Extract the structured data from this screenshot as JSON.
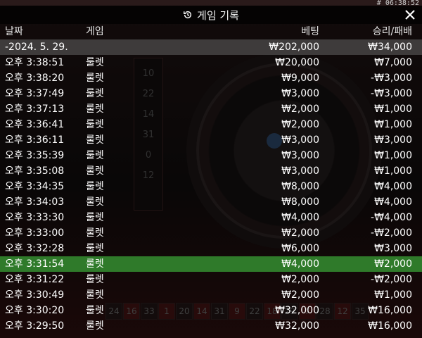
{
  "clock": "# 06:38:52",
  "header": {
    "title": "게임 기록",
    "icon": "history-icon",
    "close_icon": "close-icon"
  },
  "columns": {
    "date": "날짜",
    "game": "게임",
    "bet": "베팅",
    "result": "승리/패배"
  },
  "summary": {
    "date": "-2024. 5. 29.",
    "bet": "₩202,000",
    "result": "₩34,000"
  },
  "rows": [
    {
      "time": "오후 3:38:51",
      "game": "룰렛",
      "bet": "₩20,000",
      "result": "₩7,000"
    },
    {
      "time": "오후 3:38:20",
      "game": "룰렛",
      "bet": "₩9,000",
      "result": "-₩3,000"
    },
    {
      "time": "오후 3:37:49",
      "game": "룰렛",
      "bet": "₩3,000",
      "result": "-₩3,000"
    },
    {
      "time": "오후 3:37:13",
      "game": "룰렛",
      "bet": "₩2,000",
      "result": "₩1,000"
    },
    {
      "time": "오후 3:36:41",
      "game": "룰렛",
      "bet": "₩2,000",
      "result": "₩1,000"
    },
    {
      "time": "오후 3:36:11",
      "game": "룰렛",
      "bet": "₩3,000",
      "result": "₩3,000"
    },
    {
      "time": "오후 3:35:39",
      "game": "룰렛",
      "bet": "₩3,000",
      "result": "₩1,000"
    },
    {
      "time": "오후 3:35:08",
      "game": "룰렛",
      "bet": "₩3,000",
      "result": "₩1,000"
    },
    {
      "time": "오후 3:34:35",
      "game": "룰렛",
      "bet": "₩8,000",
      "result": "₩4,000"
    },
    {
      "time": "오후 3:34:03",
      "game": "룰렛",
      "bet": "₩8,000",
      "result": "₩4,000"
    },
    {
      "time": "오후 3:33:30",
      "game": "룰렛",
      "bet": "₩4,000",
      "result": "-₩4,000"
    },
    {
      "time": "오후 3:33:00",
      "game": "룰렛",
      "bet": "₩2,000",
      "result": "-₩2,000"
    },
    {
      "time": "오후 3:32:28",
      "game": "룰렛",
      "bet": "₩6,000",
      "result": "₩3,000"
    },
    {
      "time": "오후 3:31:54",
      "game": "룰렛",
      "bet": "₩4,000",
      "result": "₩2,000",
      "highlight": true
    },
    {
      "time": "오후 3:31:22",
      "game": "룰렛",
      "bet": "₩2,000",
      "result": "-₩2,000"
    },
    {
      "time": "오후 3:30:49",
      "game": "룰렛",
      "bet": "₩2,000",
      "result": "₩1,000"
    },
    {
      "time": "오후 3:30:20",
      "game": "룰렛",
      "bet": "₩32,000",
      "result": "₩16,000"
    },
    {
      "time": "오후 3:29:50",
      "game": "룰렛",
      "bet": "₩32,000",
      "result": "₩16,000"
    }
  ],
  "background": {
    "strip_numbers": [
      "10",
      "22",
      "14",
      "31",
      "0",
      "12"
    ],
    "number_row": [
      "24",
      "16",
      "33",
      "1",
      "20",
      "14",
      "31",
      "9",
      "22",
      "18",
      "29",
      "7",
      "28",
      "12",
      "35"
    ]
  },
  "colors": {
    "highlight": "#2f7a2a",
    "summary": "#6e6e6e",
    "panel": "#000000"
  }
}
